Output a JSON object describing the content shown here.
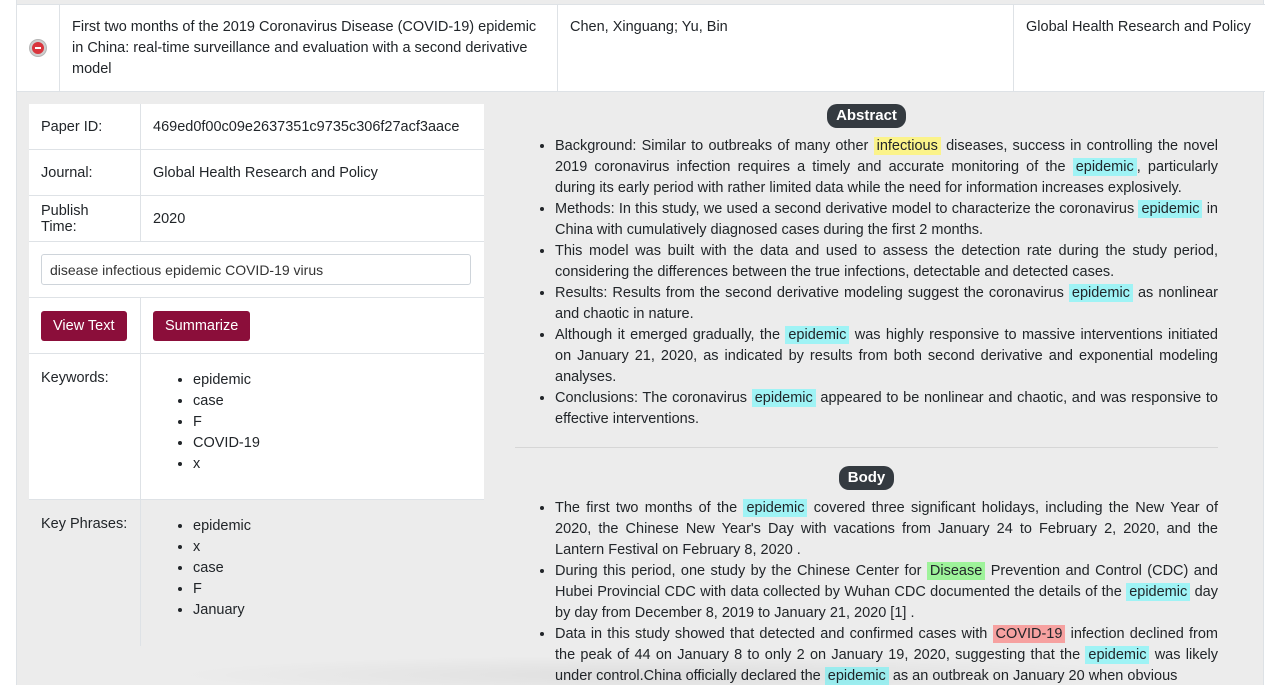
{
  "result": {
    "title": "First two months of the 2019 Coronavirus Disease (COVID-19) epidemic in China: real-time surveillance and evaluation with a second derivative model",
    "authors": "Chen, Xinguang; Yu, Bin",
    "journal": "Global Health Research and Policy"
  },
  "details": {
    "paper_id_label": "Paper ID:",
    "paper_id": "469ed0f00c09e2637351c9735c306f27acf3aace",
    "journal_label": "Journal:",
    "journal": "Global Health Research and Policy",
    "publish_label": "Publish Time:",
    "publish_time": "2020",
    "search_value": "disease infectious epidemic COVID-19 virus",
    "view_text_label": "View Text",
    "summarize_label": "Summarize",
    "keywords_label": "Keywords:",
    "keywords": [
      "epidemic",
      "case",
      "F",
      "COVID-19",
      "x"
    ],
    "phrases_label": "Key Phrases:",
    "phrases": [
      "epidemic",
      "x",
      "case",
      "F",
      "January"
    ]
  },
  "abstract": {
    "heading": "Abstract",
    "items": [
      [
        [
          "Background: Similar to outbreaks of many other ",
          ""
        ],
        [
          "infectious",
          "infectious"
        ],
        [
          " diseases, success in controlling the novel 2019 coronavirus infection requires a timely and accurate monitoring of the ",
          ""
        ],
        [
          "epidemic",
          "epidemic"
        ],
        [
          ", particularly during its early period with rather limited data while the need for information increases explosively.",
          ""
        ]
      ],
      [
        [
          "Methods: In this study, we used a second derivative model to characterize the coronavirus ",
          ""
        ],
        [
          "epidemic",
          "epidemic"
        ],
        [
          " in China with cumulatively diagnosed cases during the first 2 months.",
          ""
        ]
      ],
      [
        [
          "This model was built with the data and used to assess the detection rate during the study period, considering the differences between the true infections, detectable and detected cases.",
          ""
        ]
      ],
      [
        [
          "Results: Results from the second derivative modeling suggest the coronavirus ",
          ""
        ],
        [
          "epidemic",
          "epidemic"
        ],
        [
          " as nonlinear and chaotic in nature.",
          ""
        ]
      ],
      [
        [
          "Although it emerged gradually, the ",
          ""
        ],
        [
          "epidemic",
          "epidemic"
        ],
        [
          " was highly responsive to massive interventions initiated on January 21, 2020, as indicated by results from both second derivative and exponential modeling analyses.",
          ""
        ]
      ],
      [
        [
          "Conclusions: The coronavirus ",
          ""
        ],
        [
          "epidemic",
          "epidemic"
        ],
        [
          " appeared to be nonlinear and chaotic, and was responsive to effective interventions.",
          ""
        ]
      ]
    ]
  },
  "body": {
    "heading": "Body",
    "items": [
      [
        [
          "The first two months of the ",
          ""
        ],
        [
          "epidemic",
          "epidemic"
        ],
        [
          " covered three significant holidays, including the New Year of 2020, the Chinese New Year's Day with vacations from January 24 to February 2, 2020, and the Lantern Festival on February 8, 2020 .",
          ""
        ]
      ],
      [
        [
          "During this period, one study by the Chinese Center for ",
          ""
        ],
        [
          "Disease",
          "disease"
        ],
        [
          " Prevention and Control (CDC) and Hubei Provincial CDC with data collected by Wuhan CDC documented the details of the ",
          ""
        ],
        [
          "epidemic",
          "epidemic"
        ],
        [
          " day by day from December 8, 2019 to January 21, 2020 [1] .",
          ""
        ]
      ],
      [
        [
          "Data in this study showed that detected and confirmed cases with ",
          ""
        ],
        [
          "COVID-19",
          "covid"
        ],
        [
          " infection declined from the peak of 44 on January 8 to only 2 on January 19, 2020, suggesting that the ",
          ""
        ],
        [
          "epidemic",
          "epidemic"
        ],
        [
          " was likely under control.China officially declared the ",
          ""
        ],
        [
          "epidemic",
          "epidemic"
        ],
        [
          " as an outbreak on January 20 when obvious",
          ""
        ]
      ]
    ]
  },
  "colors": {
    "highlight_epidemic": "#9ff3f5",
    "highlight_infectious": "#fbf38a",
    "highlight_disease": "#9ef39a",
    "highlight_covid": "#f6a1a0",
    "button": "#8b0e3a",
    "collapse_icon": "#d9363e"
  }
}
